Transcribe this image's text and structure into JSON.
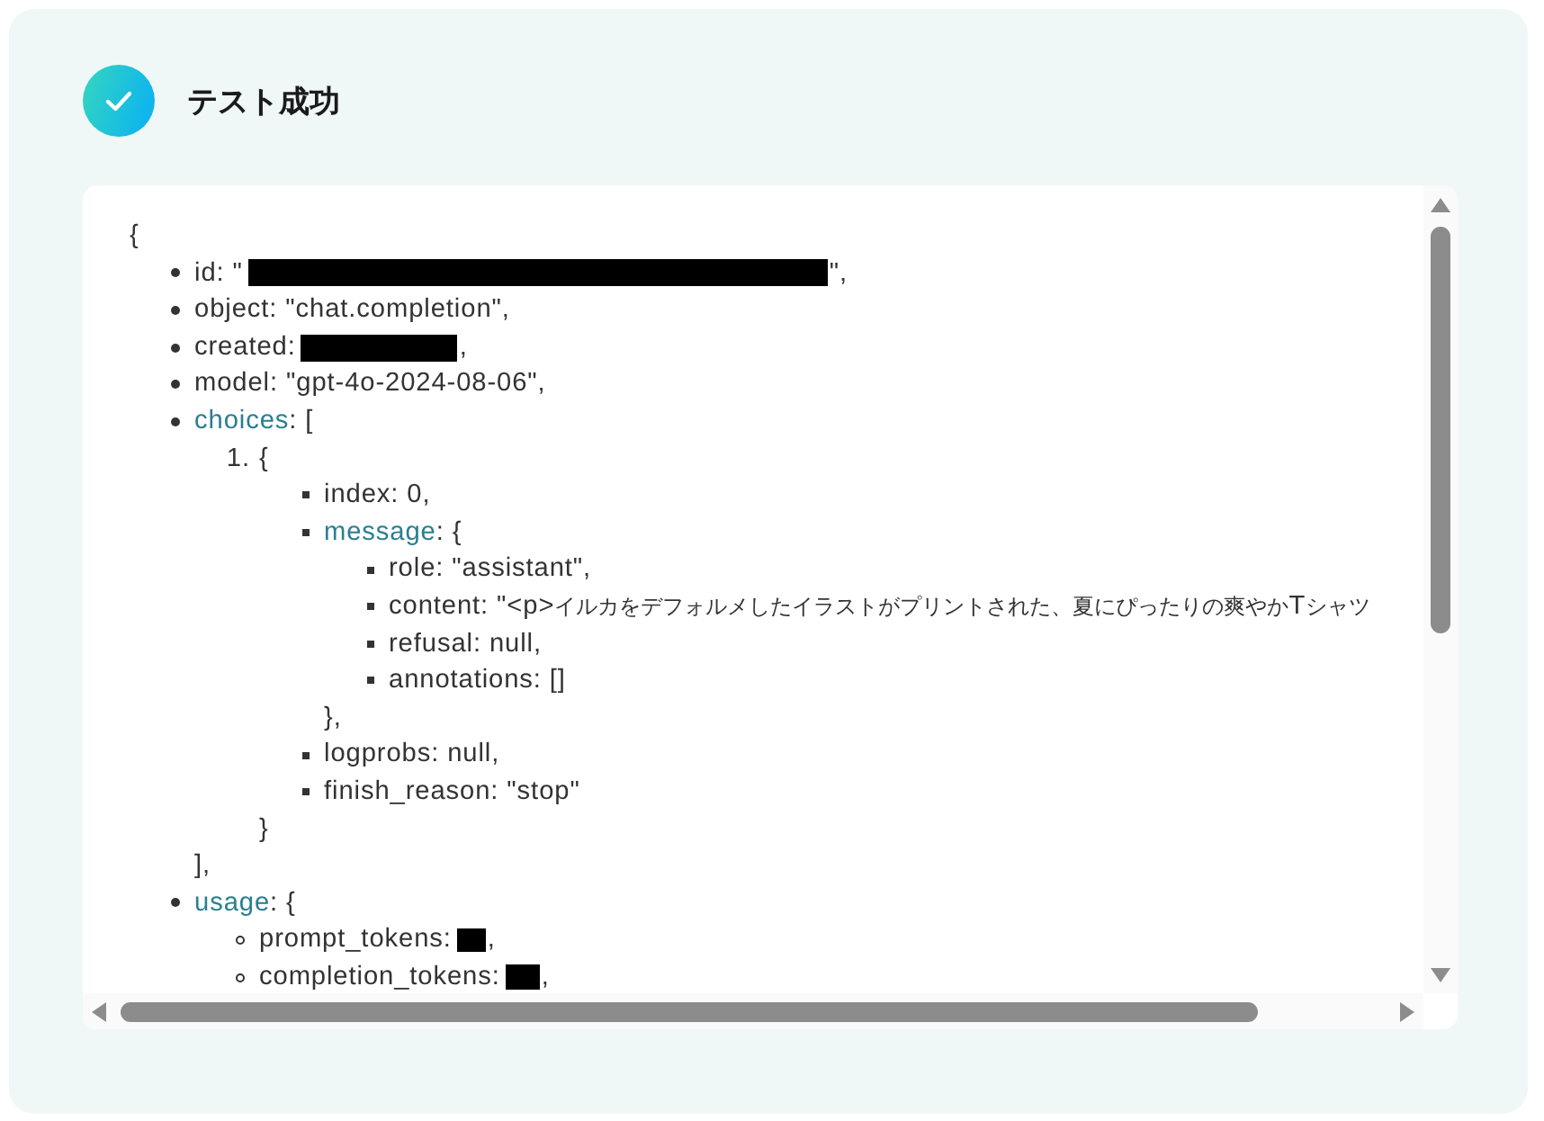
{
  "result": {
    "title": "テスト成功"
  },
  "viewer": {
    "open": "{",
    "items": [
      {
        "kind": "value",
        "key": "id",
        "text": ": \"",
        "redacted": true,
        "after": "\","
      },
      {
        "kind": "value",
        "key": "object",
        "text": ": \"chat.completion\","
      },
      {
        "kind": "value",
        "key": "created",
        "text": ":",
        "redacted": true,
        "after": ","
      },
      {
        "kind": "value",
        "key": "model",
        "text": ": \"gpt-4o-2024-08-06\","
      },
      {
        "kind": "group",
        "key": "choices",
        "text": ": [",
        "close": "],",
        "children": [
          {
            "kind": "element",
            "number": "1.",
            "text": "{",
            "close": "}",
            "children": [
              {
                "kind": "value",
                "key": "index",
                "text": ": 0,"
              },
              {
                "kind": "group",
                "key": "message",
                "text": ": {",
                "close": "},",
                "children": [
                  {
                    "kind": "value",
                    "key": "role",
                    "text": ": \"assistant\","
                  },
                  {
                    "kind": "value",
                    "key": "content",
                    "text": ": \"<p>イルカをデフォルメしたイラストがプリントされた、夏にぴったりの爽やかTシャツ"
                  },
                  {
                    "kind": "value",
                    "key": "refusal",
                    "text": ": null,"
                  },
                  {
                    "kind": "value",
                    "key": "annotations",
                    "text": ": []"
                  }
                ]
              },
              {
                "kind": "value",
                "key": "logprobs",
                "text": ": null,"
              },
              {
                "kind": "value",
                "key": "finish_reason",
                "text": ": \"stop\""
              }
            ]
          }
        ]
      },
      {
        "kind": "group",
        "key": "usage",
        "text": ": {",
        "children": [
          {
            "kind": "value",
            "key": "prompt_tokens",
            "text": ":",
            "redacted": true,
            "after": ","
          },
          {
            "kind": "value",
            "key": "completion_tokens",
            "text": ":",
            "redacted": true,
            "after": ","
          }
        ]
      }
    ]
  }
}
